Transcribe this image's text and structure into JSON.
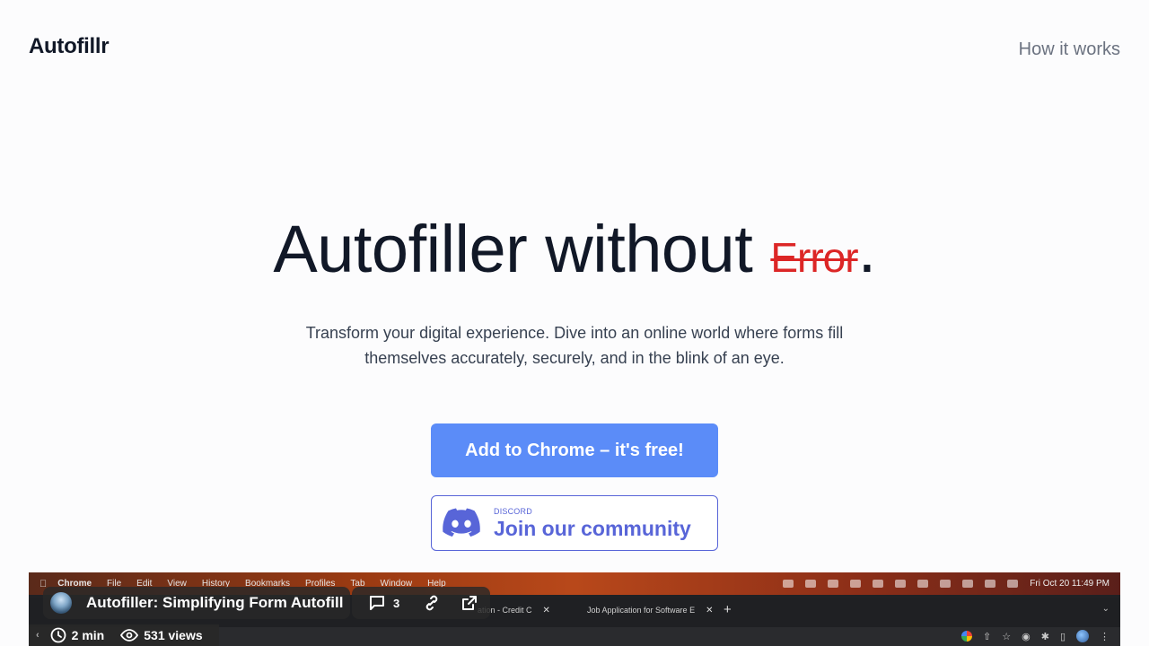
{
  "header": {
    "logo": "Autofillr",
    "nav_link": "How it works"
  },
  "hero": {
    "title_main": "Autofiller without ",
    "title_strike": "Error",
    "title_end": ".",
    "subtitle": "Transform your digital experience. Dive into an online world where forms fill themselves accurately, securely, and in the blink of an eye."
  },
  "cta": {
    "label": "Add to Chrome – it's free!",
    "color": "#5b8cf8"
  },
  "discord": {
    "small_label": "DISCORD",
    "big_label": "Join our community",
    "icon": "discord-icon",
    "color": "#5865d8"
  },
  "video": {
    "title": "Autofiller: Simplifying Form Autofill",
    "comments_count": "3",
    "duration": "2 min",
    "views": "531 views",
    "menubar": {
      "items": [
        "Chrome",
        "File",
        "Edit",
        "View",
        "History",
        "Bookmarks",
        "Profiles",
        "Tab",
        "Window",
        "Help"
      ],
      "clock": "Fri Oct 20  11:49 PM"
    },
    "tabs": [
      {
        "label": "ation - Credit C"
      },
      {
        "label": "Job Application for Software E"
      }
    ]
  }
}
